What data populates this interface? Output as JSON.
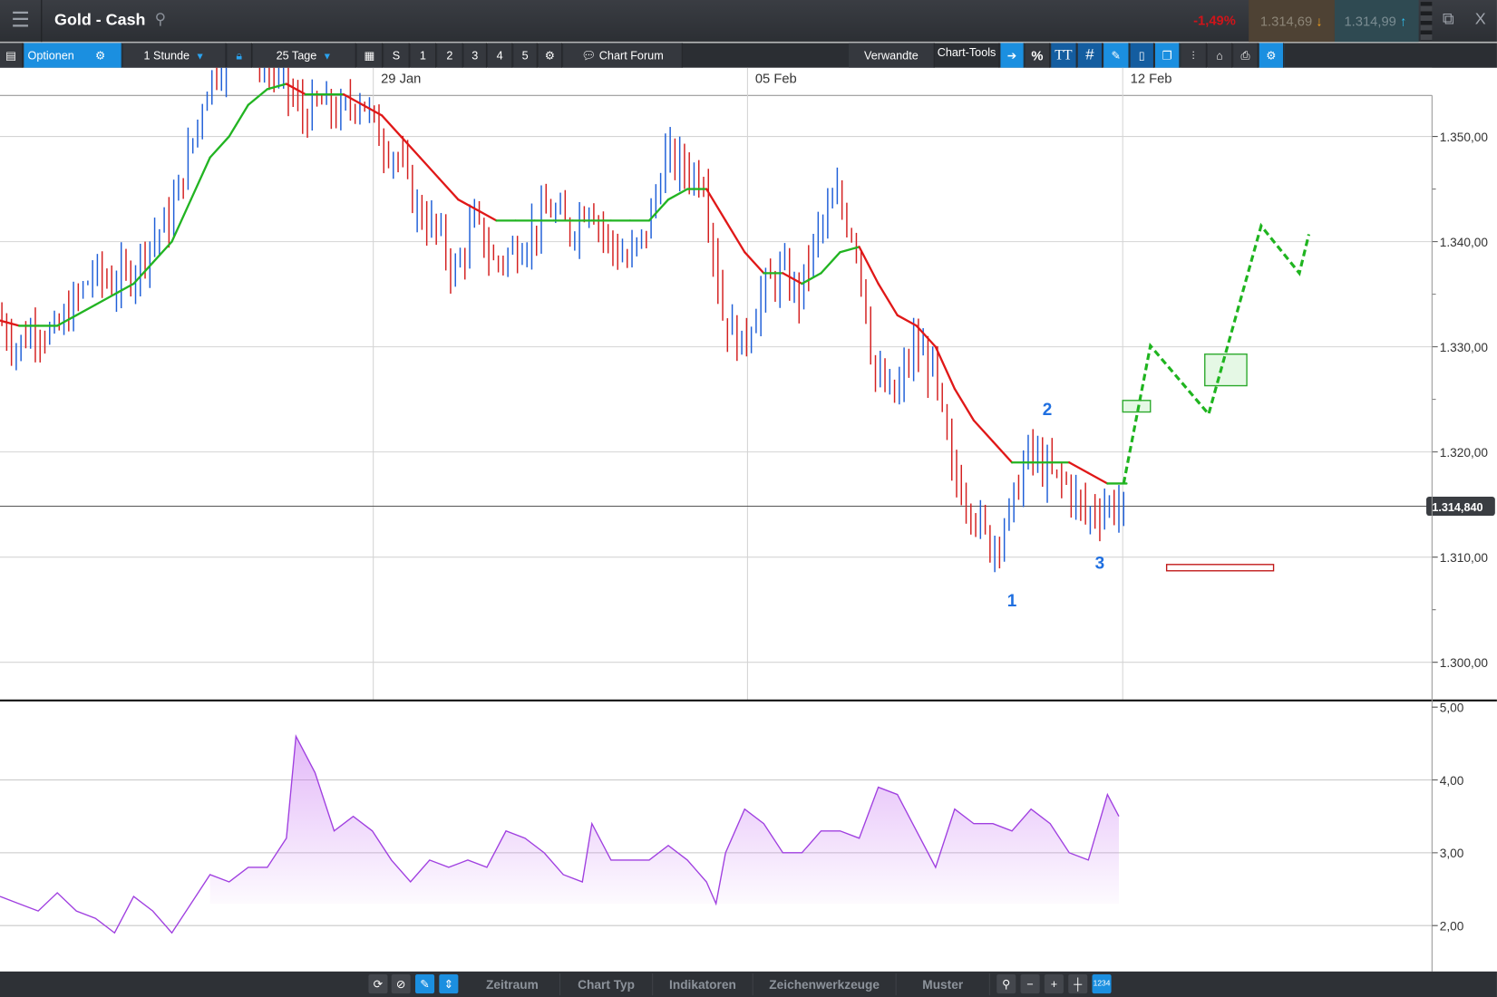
{
  "header": {
    "title": "Gold - Cash",
    "change": "-1,49%",
    "bid": "1.314,69",
    "ask": "1.314,99",
    "close_label": "X"
  },
  "toolbar": {
    "options": "Optionen",
    "interval": "1 Stunde",
    "range": "25 Tage",
    "presets": [
      "S",
      "1",
      "2",
      "3",
      "4",
      "5"
    ],
    "forum": "Chart Forum",
    "related": "Verwandte",
    "chart_tools": "Chart-Tools",
    "percent": "%",
    "text_tool": "TT"
  },
  "bottombar": {
    "tabs": [
      "Zeitraum",
      "Chart Typ",
      "Indikatoren",
      "Zeichenwerkzeuge",
      "Muster"
    ]
  },
  "colors": {
    "up": "#1f5fd8",
    "down": "#d42020",
    "ma_up": "#22b422",
    "ma_down": "#e01818",
    "projection": "#1fb41f",
    "indicator": "#a040e0"
  },
  "chart_data": {
    "type": "line",
    "title": "Gold - Cash",
    "x_ticks": [
      {
        "label": "29 Jan",
        "x": 19.55
      },
      {
        "label": "05 Feb",
        "x": 39.15
      },
      {
        "label": "12 Feb",
        "x": 58.8
      }
    ],
    "price_axis": {
      "ylim": [
        1296.5,
        1359
      ],
      "ticks": [
        "1.300,00",
        "1.310,00",
        "1.320,00",
        "1.330,00",
        "1.340,00",
        "1.350,00"
      ],
      "tick_values": [
        1300,
        1310,
        1320,
        1330,
        1340,
        1350
      ]
    },
    "last_price": {
      "value": 1314.84,
      "label": "1.314,840"
    },
    "closes": [
      1333,
      1330,
      1332,
      1331,
      1334,
      1337,
      1336,
      1337,
      1340,
      1342,
      1348,
      1355,
      1358,
      1360,
      1357,
      1355,
      1352,
      1353,
      1352,
      1354,
      1350,
      1348,
      1343,
      1341,
      1337,
      1342,
      1338,
      1339,
      1341,
      1343,
      1341,
      1344,
      1340,
      1338,
      1341,
      1348,
      1347,
      1346,
      1333,
      1330,
      1335,
      1337,
      1335,
      1341,
      1344,
      1340,
      1327,
      1325,
      1330,
      1328,
      1318,
      1315,
      1311,
      1314,
      1320,
      1318,
      1317,
      1314,
      1315,
      1314.84
    ],
    "moving_average": [
      1332.5,
      1332,
      1332,
      1332,
      1333,
      1334,
      1335,
      1336,
      1338,
      1340,
      1344,
      1348,
      1350,
      1353,
      1354.5,
      1355,
      1354,
      1354,
      1354,
      1353,
      1352,
      1350,
      1348,
      1346,
      1344,
      1343,
      1342,
      1342,
      1342,
      1342,
      1342,
      1342,
      1342,
      1342,
      1342,
      1344,
      1345,
      1345,
      1342,
      1339,
      1337,
      1337,
      1336,
      1337,
      1339,
      1339.5,
      1336,
      1333,
      1332,
      1330,
      1326,
      1323,
      1321,
      1319,
      1319,
      1319,
      1319,
      1318,
      1317,
      1317
    ],
    "projection": [
      [
        58.85,
        1317
      ],
      [
        60.25,
        1330.1
      ],
      [
        63.3,
        1323.6
      ],
      [
        66.05,
        1341.5
      ],
      [
        68.05,
        1337
      ],
      [
        68.55,
        1340.7
      ]
    ],
    "boxes": [
      {
        "x": [
          58.8,
          60.25
        ],
        "y": [
          1323.8,
          1324.9
        ],
        "color": "green"
      },
      {
        "x": [
          63.1,
          65.3
        ],
        "y": [
          1326.3,
          1329.3
        ],
        "color": "green"
      },
      {
        "x": [
          61.1,
          66.7
        ],
        "y": [
          1308.7,
          1309.3
        ],
        "color": "red"
      }
    ],
    "wave_labels": [
      {
        "text": "1",
        "x": 53,
        "y": 1305.3
      },
      {
        "text": "2",
        "x": 54.85,
        "y": 1323.5
      },
      {
        "text": "3",
        "x": 57.6,
        "y": 1308.9
      }
    ],
    "indicator": {
      "ylim": [
        1.35,
        5
      ],
      "ticks": [
        "2,00",
        "3,00",
        "4,00",
        "5,00"
      ],
      "tick_values": [
        2,
        3,
        4,
        5
      ],
      "x": [
        0,
        1,
        2,
        3,
        4,
        5,
        6,
        7,
        8,
        9,
        10,
        11,
        12,
        13,
        14,
        15,
        15.5,
        16.5,
        17.5,
        18.5,
        19.5,
        20.5,
        21.5,
        22.5,
        23.5,
        24.5,
        25.5,
        26.5,
        27.5,
        28.5,
        29.5,
        30.5,
        31,
        32,
        33,
        34,
        35,
        36,
        37,
        37.5,
        38,
        39,
        40,
        41,
        42,
        43,
        44,
        45,
        46,
        47,
        48,
        49,
        50,
        51,
        52,
        53,
        54,
        55,
        56,
        57,
        58,
        58.6
      ],
      "values": [
        2.4,
        2.3,
        2.2,
        2.45,
        2.2,
        2.1,
        1.9,
        2.4,
        2.2,
        1.9,
        2.3,
        2.7,
        2.6,
        2.8,
        2.8,
        3.2,
        4.6,
        4.1,
        3.3,
        3.5,
        3.3,
        2.9,
        2.6,
        2.9,
        2.8,
        2.9,
        2.8,
        3.3,
        3.2,
        3.0,
        2.7,
        2.6,
        3.4,
        2.9,
        2.9,
        2.9,
        3.1,
        2.9,
        2.6,
        2.3,
        3.0,
        3.6,
        3.4,
        3.0,
        3.0,
        3.3,
        3.3,
        3.2,
        3.9,
        3.8,
        3.3,
        2.8,
        3.6,
        3.4,
        3.4,
        3.3,
        3.6,
        3.4,
        3.0,
        2.9,
        3.8,
        3.5
      ]
    }
  }
}
